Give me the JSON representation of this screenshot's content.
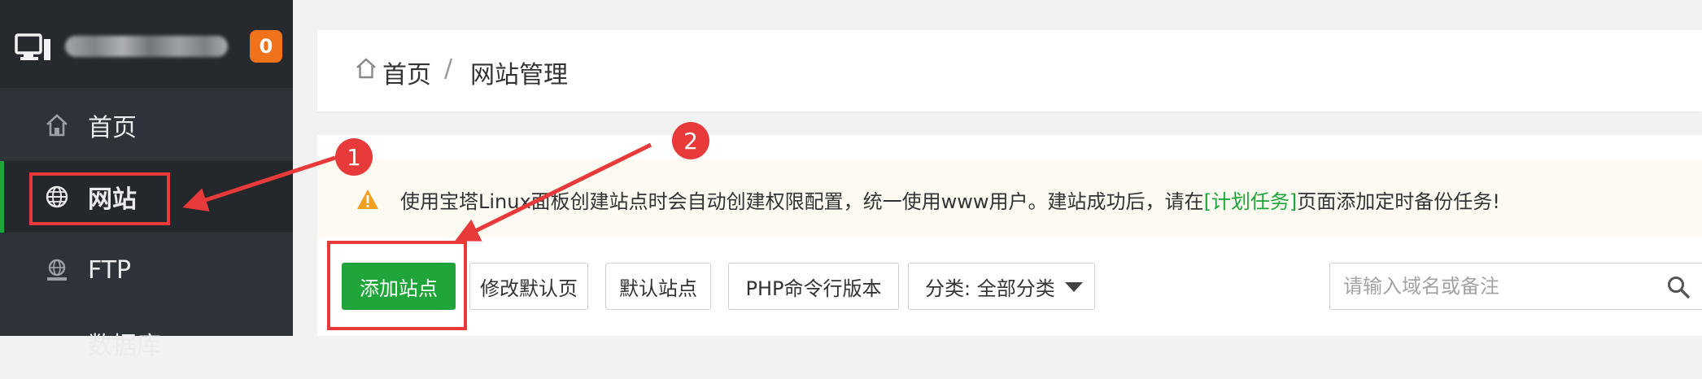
{
  "sidebar": {
    "message_count": "0",
    "items": [
      {
        "label": "首页",
        "icon": "home-icon"
      },
      {
        "label": "网站",
        "icon": "globe-icon",
        "active": true
      },
      {
        "label": "FTP",
        "icon": "ftp-icon"
      },
      {
        "label": "数据库",
        "icon": "database-icon"
      }
    ]
  },
  "breadcrumb": {
    "home": "首页",
    "separator": "/",
    "current": "网站管理"
  },
  "tip": {
    "text_before": "使用宝塔Linux面板创建站点时会自动创建权限配置，统一使用www用户。建站成功后，请在",
    "link": "[计划任务]",
    "text_after": "页面添加定时备份任务!"
  },
  "toolbar": {
    "add_site": "添加站点",
    "modify_default_page": "修改默认页",
    "default_site": "默认站点",
    "php_cli_version": "PHP命令行版本",
    "category": "分类: 全部分类",
    "search_placeholder": "请输入域名或备注"
  },
  "annotations": {
    "step1": "1",
    "step2": "2"
  },
  "colors": {
    "accent_green": "#20a53a",
    "sidebar_bg": "#2e3339",
    "badge_orange": "#f0731c",
    "annotation_red": "#e83a3a"
  }
}
